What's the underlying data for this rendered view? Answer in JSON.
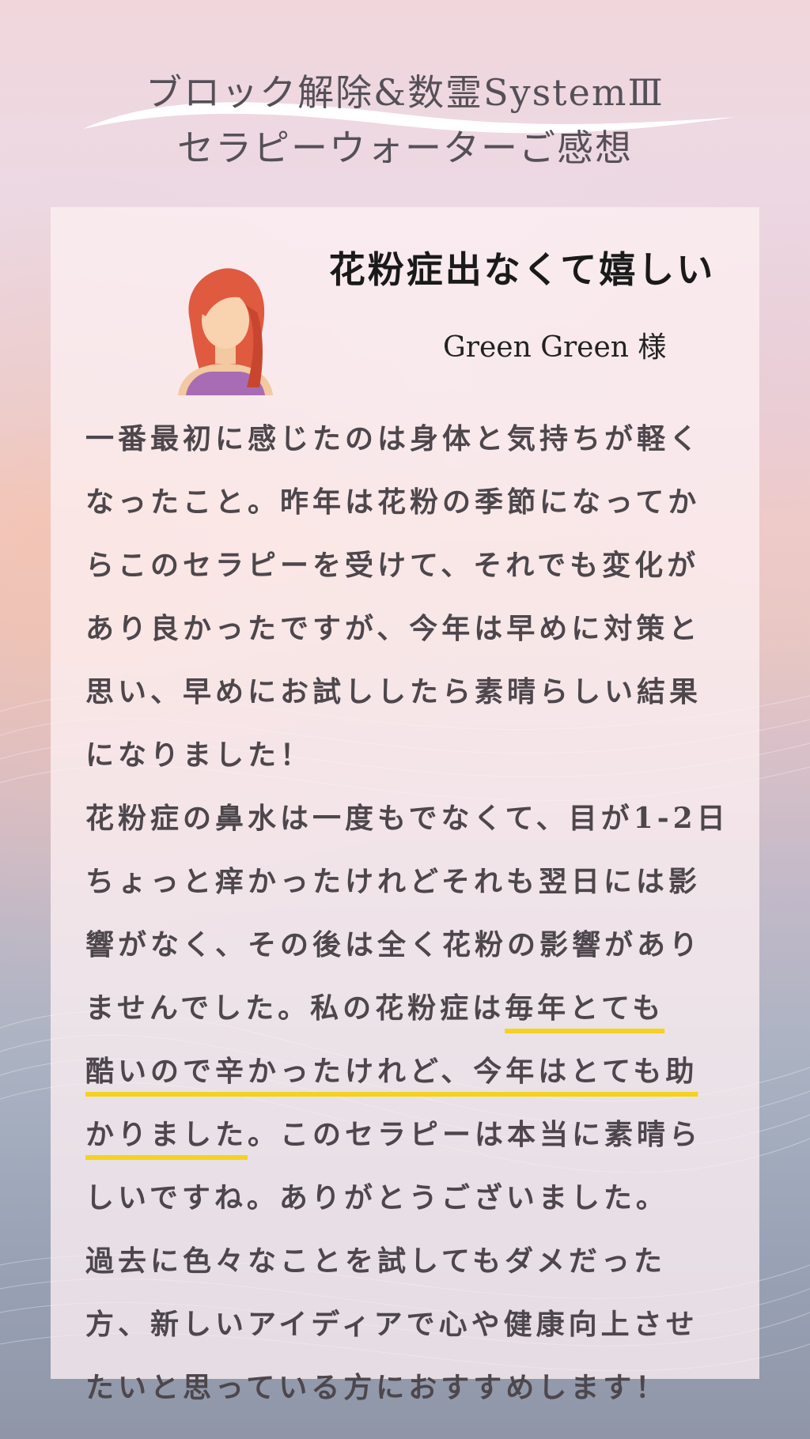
{
  "header": {
    "title_line1": "ブロック解除&数霊SystemⅢ",
    "title_line2": "セラピーウォーターご感想"
  },
  "testimonial": {
    "headline": "花粉症出なくて嬉しい",
    "customer": "Green Green 様",
    "avatar": "woman-avatar-icon",
    "body_lines": [
      {
        "text": "一番最初に感じたのは身体と気持ちが軽く"
      },
      {
        "text": "なったこと。昨年は花粉の季節になってか"
      },
      {
        "text": "らこのセラピーを受けて、それでも変化が"
      },
      {
        "text": "あり良かったですが、今年は早めに対策と"
      },
      {
        "text": "思い、早めにお試ししたら素晴らしい結果"
      },
      {
        "text": "になりました！"
      },
      {
        "text": "花粉症の鼻水は一度もでなくて、目が1-2日"
      },
      {
        "text": "ちょっと痒かったけれどそれも翌日には影"
      },
      {
        "text": "響がなく、その後は全く花粉の影響があり"
      },
      {
        "before": "ませんでした。私の花粉症は",
        "highlight": "毎年とても",
        "after": ""
      },
      {
        "before": "",
        "highlight": "酷いので辛かったけれど、今年はとても助",
        "after": ""
      },
      {
        "before": "",
        "highlight": "かりました",
        "after": "。このセラピーは本当に素晴ら"
      },
      {
        "text": "しいですね。ありがとうございました。"
      },
      {
        "text": "過去に色々なことを試してもダメだった"
      },
      {
        "text": "方、新しいアイディアで心や健康向上させ"
      },
      {
        "text": "たいと思っている方におすすめします！"
      }
    ]
  },
  "colors": {
    "highlight_underline": "#f5d21f",
    "body_text": "#4d474c",
    "title_text": "#555057"
  }
}
